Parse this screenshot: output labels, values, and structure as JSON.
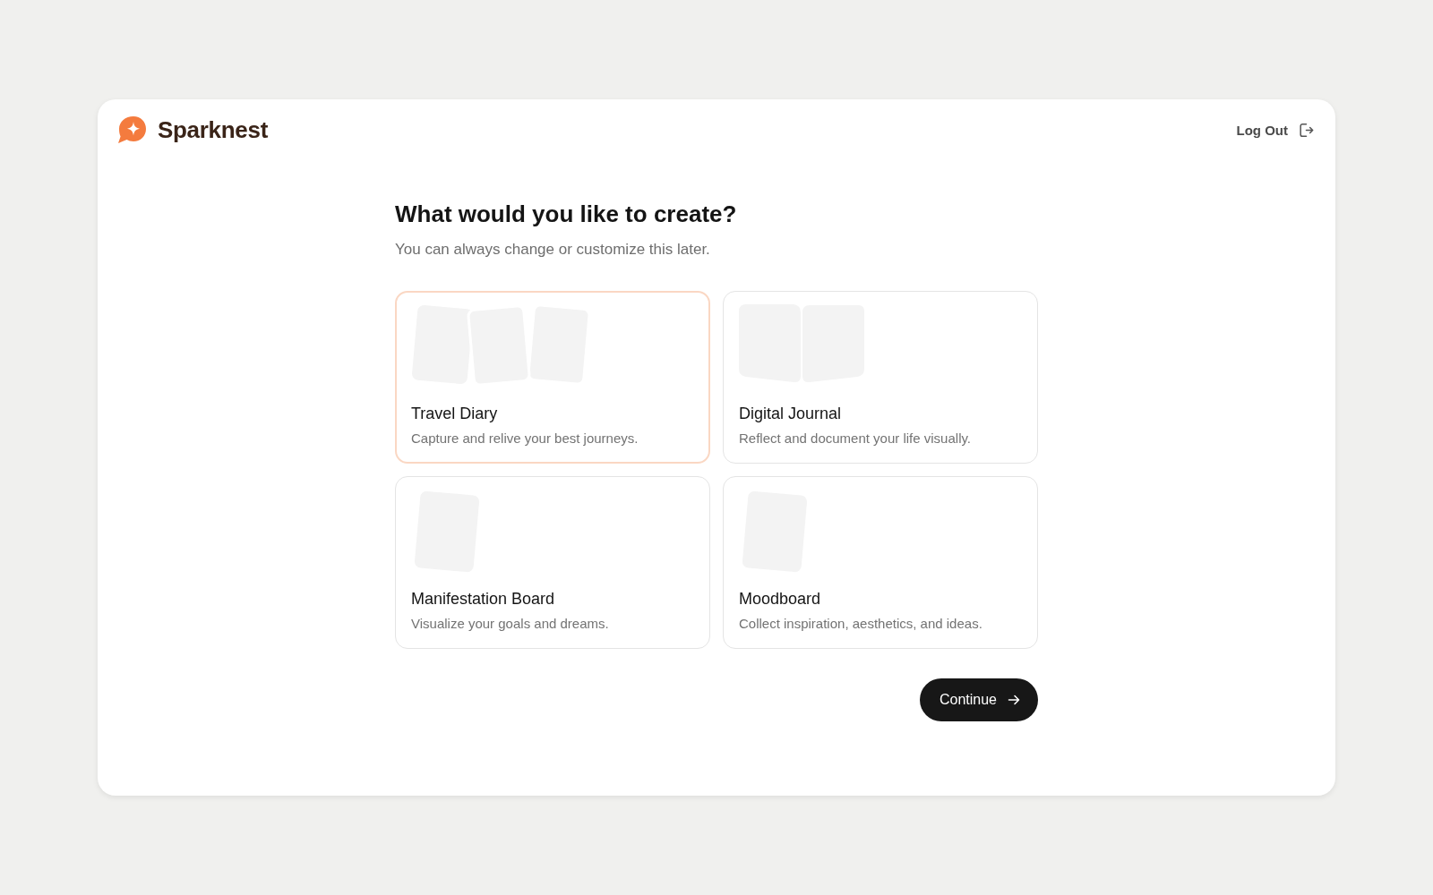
{
  "header": {
    "brand": "Sparknest",
    "logout": {
      "label": "Log Out"
    }
  },
  "heading": "What would you like to create?",
  "subtitle": "You can always change or customize this later.",
  "options": [
    {
      "kind": "stack",
      "title": "Travel Diary",
      "description": "Capture and relive your best journeys.",
      "selected": true
    },
    {
      "kind": "spread",
      "title": "Digital Journal",
      "description": "Reflect and document your life visually.",
      "selected": false
    },
    {
      "kind": "single",
      "title": "Manifestation Board",
      "description": "Visualize your goals and dreams.",
      "selected": false
    },
    {
      "kind": "single",
      "title": "Moodboard",
      "description": "Collect inspiration, aesthetics, and ideas.",
      "selected": false
    }
  ],
  "continue_button": {
    "label": "Continue"
  }
}
